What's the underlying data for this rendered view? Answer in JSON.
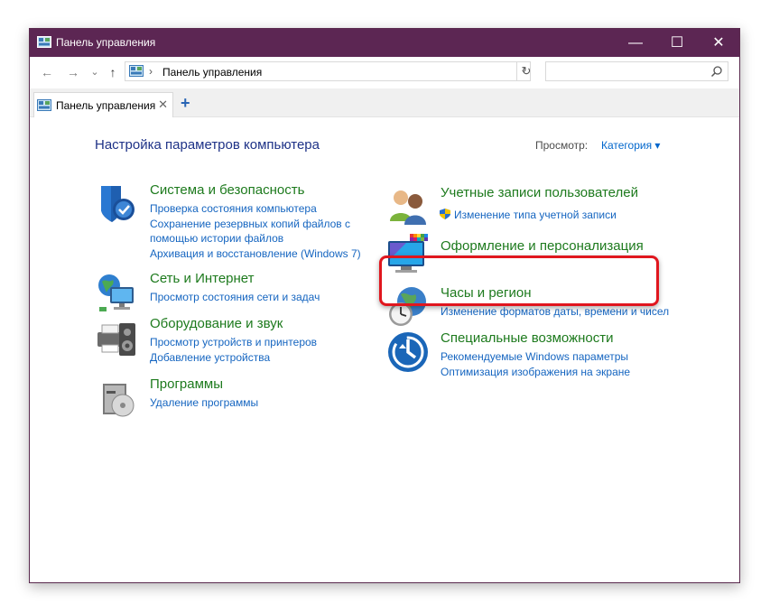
{
  "window": {
    "title": "Панель управления",
    "controls": {
      "minimize": "—",
      "maximize": "☐",
      "close": "✕"
    }
  },
  "address_bar": {
    "back": "←",
    "forward": "→",
    "recent": "⌄",
    "up": "↑",
    "separator": "›",
    "path": "Панель управления",
    "dropdown": "⌄",
    "refresh": "↻",
    "search_placeholder": ""
  },
  "tabs": [
    {
      "label": "Панель управления",
      "close": "✕"
    }
  ],
  "new_tab": "+",
  "main": {
    "heading": "Настройка параметров компьютера",
    "view_by_label": "Просмотр:",
    "view_by_value": "Категория ▾",
    "left_categories": [
      {
        "title": "Система и безопасность",
        "icon": "shield-icon",
        "links": [
          "Проверка состояния компьютера",
          "Сохранение резервных копий файлов с",
          "помощью истории файлов",
          "Архивация и восстановление (Windows 7)"
        ]
      },
      {
        "title": "Сеть и Интернет",
        "icon": "network-globe-icon",
        "links": [
          "Просмотр состояния сети и задач"
        ]
      },
      {
        "title": "Оборудование и звук",
        "icon": "printer-speaker-icon",
        "links": [
          "Просмотр устройств и принтеров",
          "Добавление устройства"
        ]
      },
      {
        "title": "Программы",
        "icon": "programs-icon",
        "links": [
          "Удаление программы"
        ]
      }
    ],
    "right_categories": [
      {
        "title": "Учетные записи пользователей",
        "icon": "users-icon",
        "links": [
          "Изменение типа учетной записи"
        ]
      },
      {
        "title": "Оформление и персонализация",
        "icon": "monitor-palette-icon",
        "links": []
      },
      {
        "title": "Часы и регион",
        "icon": "clock-globe-icon",
        "links": [
          "Изменение форматов даты, времени и чисел"
        ]
      },
      {
        "title": "Специальные возможности",
        "icon": "ease-of-access-icon",
        "links": [
          "Рекомендуемые Windows параметры",
          "Оптимизация изображения на экране"
        ]
      }
    ]
  },
  "colors": {
    "titlebar": "#5c2653",
    "heading": "#1e3287",
    "category_title": "#1d7a1d",
    "link": "#1565c0",
    "highlight": "#e0161e"
  }
}
